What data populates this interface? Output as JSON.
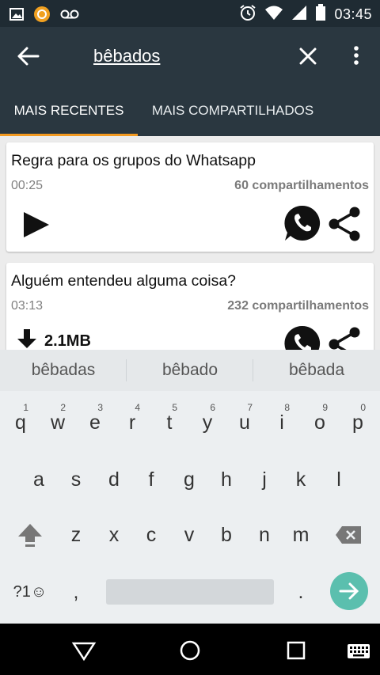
{
  "status_bar": {
    "time": "03:45",
    "icons": [
      "image-icon",
      "app-notification-icon",
      "voicemail-icon",
      "alarm-icon",
      "wifi-icon",
      "signal-icon",
      "battery-icon"
    ]
  },
  "toolbar": {
    "search_value": "bêbados",
    "icons": [
      "back-arrow-icon",
      "close-icon",
      "overflow-menu-icon"
    ]
  },
  "tabs": [
    {
      "label": "MAIS RECENTES",
      "active": true
    },
    {
      "label": "MAIS COMPARTILHADOS",
      "active": false
    }
  ],
  "cards": [
    {
      "title": "Regra para os grupos do Whatsapp",
      "duration": "00:25",
      "shares": "60 compartilhamentos",
      "action": "play"
    },
    {
      "title": "Alguém entendeu alguma coisa?",
      "duration": "03:13",
      "shares": "232 compartilhamentos",
      "action": "download",
      "size": "2.1MB"
    }
  ],
  "keyboard": {
    "suggestions": [
      "bêbadas",
      "bêbado",
      "bêbada"
    ],
    "row1": [
      "q",
      "w",
      "e",
      "r",
      "t",
      "y",
      "u",
      "i",
      "o",
      "p"
    ],
    "row1_hints": [
      "1",
      "2",
      "3",
      "4",
      "5",
      "6",
      "7",
      "8",
      "9",
      "0"
    ],
    "row2": [
      "a",
      "s",
      "d",
      "f",
      "g",
      "h",
      "j",
      "k",
      "l"
    ],
    "row3": [
      "z",
      "x",
      "c",
      "v",
      "b",
      "n",
      "m"
    ],
    "symbols_label": "?1☺",
    "comma": ",",
    "period": "."
  },
  "colors": {
    "toolbar": "#2a3740",
    "status_bar": "#1f2b33",
    "tab_indicator": "#f39a21",
    "enter_key": "#5bbfae"
  }
}
